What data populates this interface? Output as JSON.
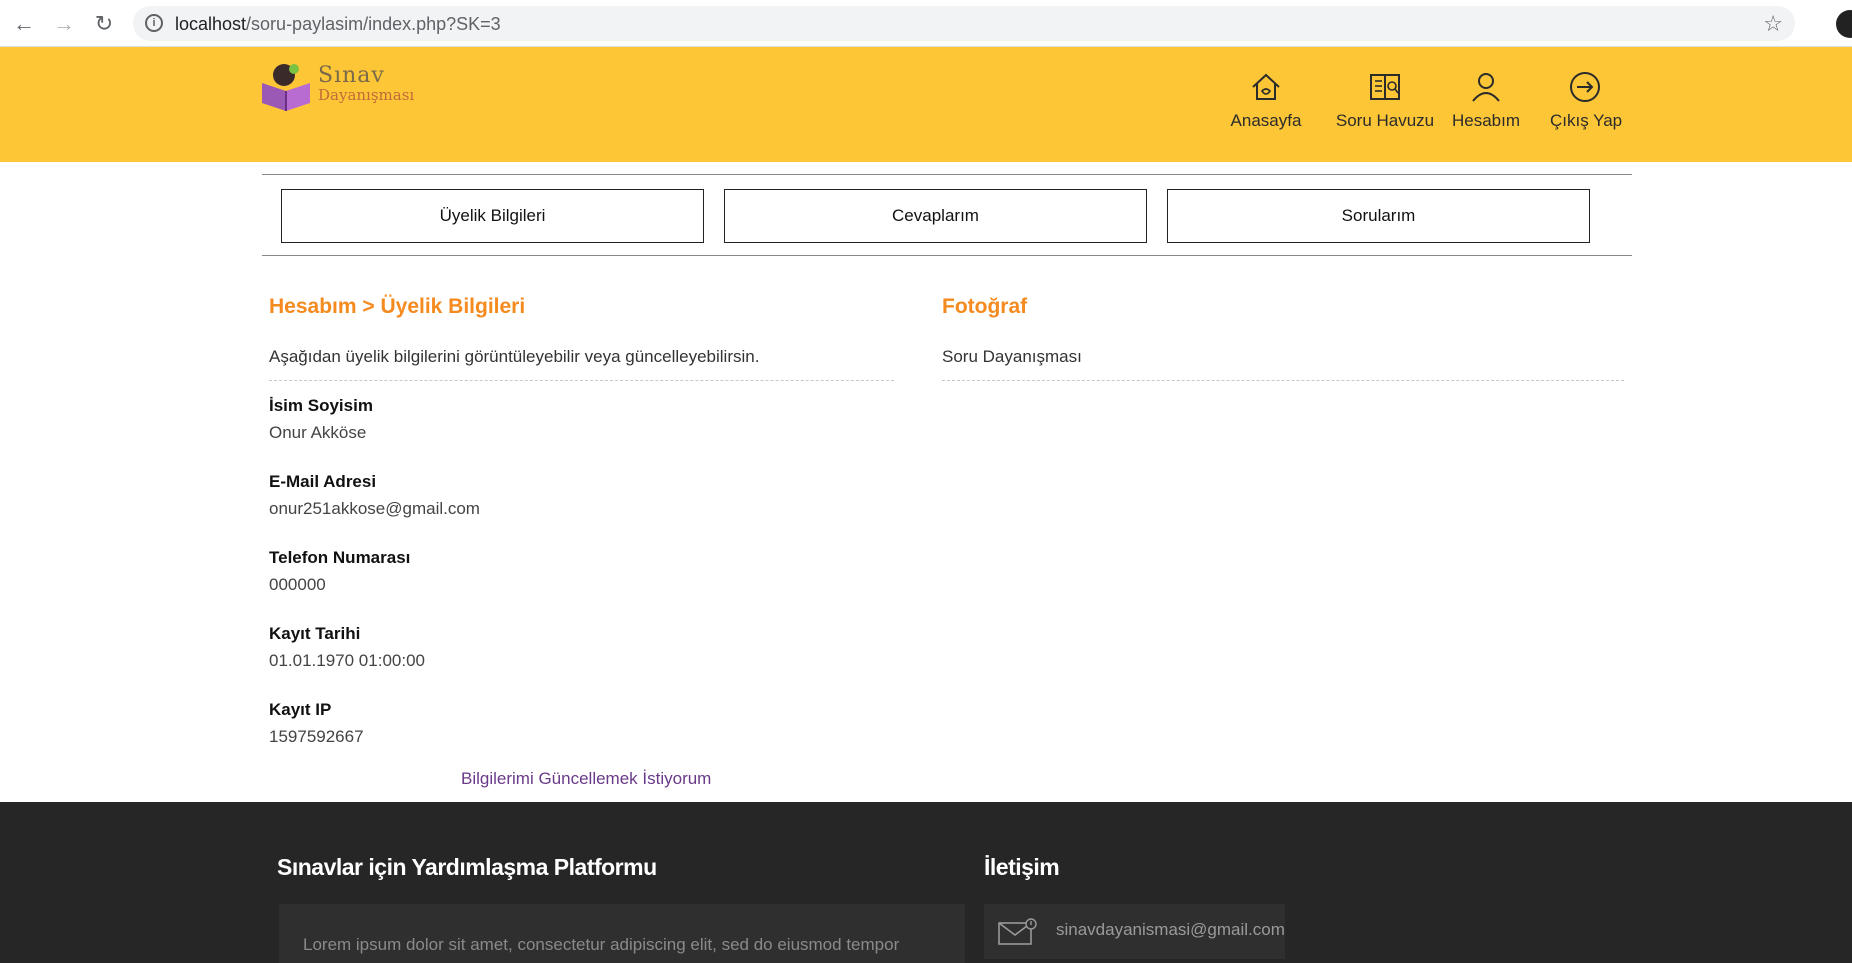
{
  "browser": {
    "url_host": "localhost",
    "url_path": "/soru-paylasim/index.php?SK=3"
  },
  "logo": {
    "line1": "Sınav",
    "line2": "Dayanışması"
  },
  "nav": [
    {
      "label": "Anasayfa",
      "icon": "home-icon"
    },
    {
      "label": "Soru Havuzu",
      "icon": "book-icon"
    },
    {
      "label": "Hesabım",
      "icon": "user-icon"
    },
    {
      "label": "Çıkış Yap",
      "icon": "logout-icon"
    }
  ],
  "tabs": [
    {
      "label": "Üyelik Bilgileri"
    },
    {
      "label": "Cevaplarım"
    },
    {
      "label": "Sorularım"
    }
  ],
  "account": {
    "title": "Hesabım > Üyelik Bilgileri",
    "description": "Aşağıdan üyelik bilgilerini görüntüleyebilir veya güncelleyebilirsin.",
    "fields": [
      {
        "label": "İsim Soyisim",
        "value": "Onur Akköse"
      },
      {
        "label": "E-Mail Adresi",
        "value": "onur251akkose@gmail.com"
      },
      {
        "label": "Telefon Numarası",
        "value": "000000"
      },
      {
        "label": "Kayıt Tarihi",
        "value": "01.01.1970 01:00:00"
      },
      {
        "label": "Kayıt IP",
        "value": "1597592667"
      }
    ],
    "update_link": "Bilgilerimi Güncellemek İstiyorum"
  },
  "photo": {
    "title": "Fotoğraf",
    "description": "Soru Dayanışması"
  },
  "footer": {
    "about_title": "Sınavlar için Yardımlaşma Platformu",
    "about_text": "Lorem ipsum dolor sit amet, consectetur adipiscing elit, sed do eiusmod tempor",
    "contact_title": "İletişim",
    "contact_email": "sinavdayanismasi@gmail.com"
  },
  "colors": {
    "header_bg": "#fdc636",
    "accent_orange": "#f58a1f",
    "footer_bg": "#262626",
    "link_purple": "#6a3a8a"
  }
}
